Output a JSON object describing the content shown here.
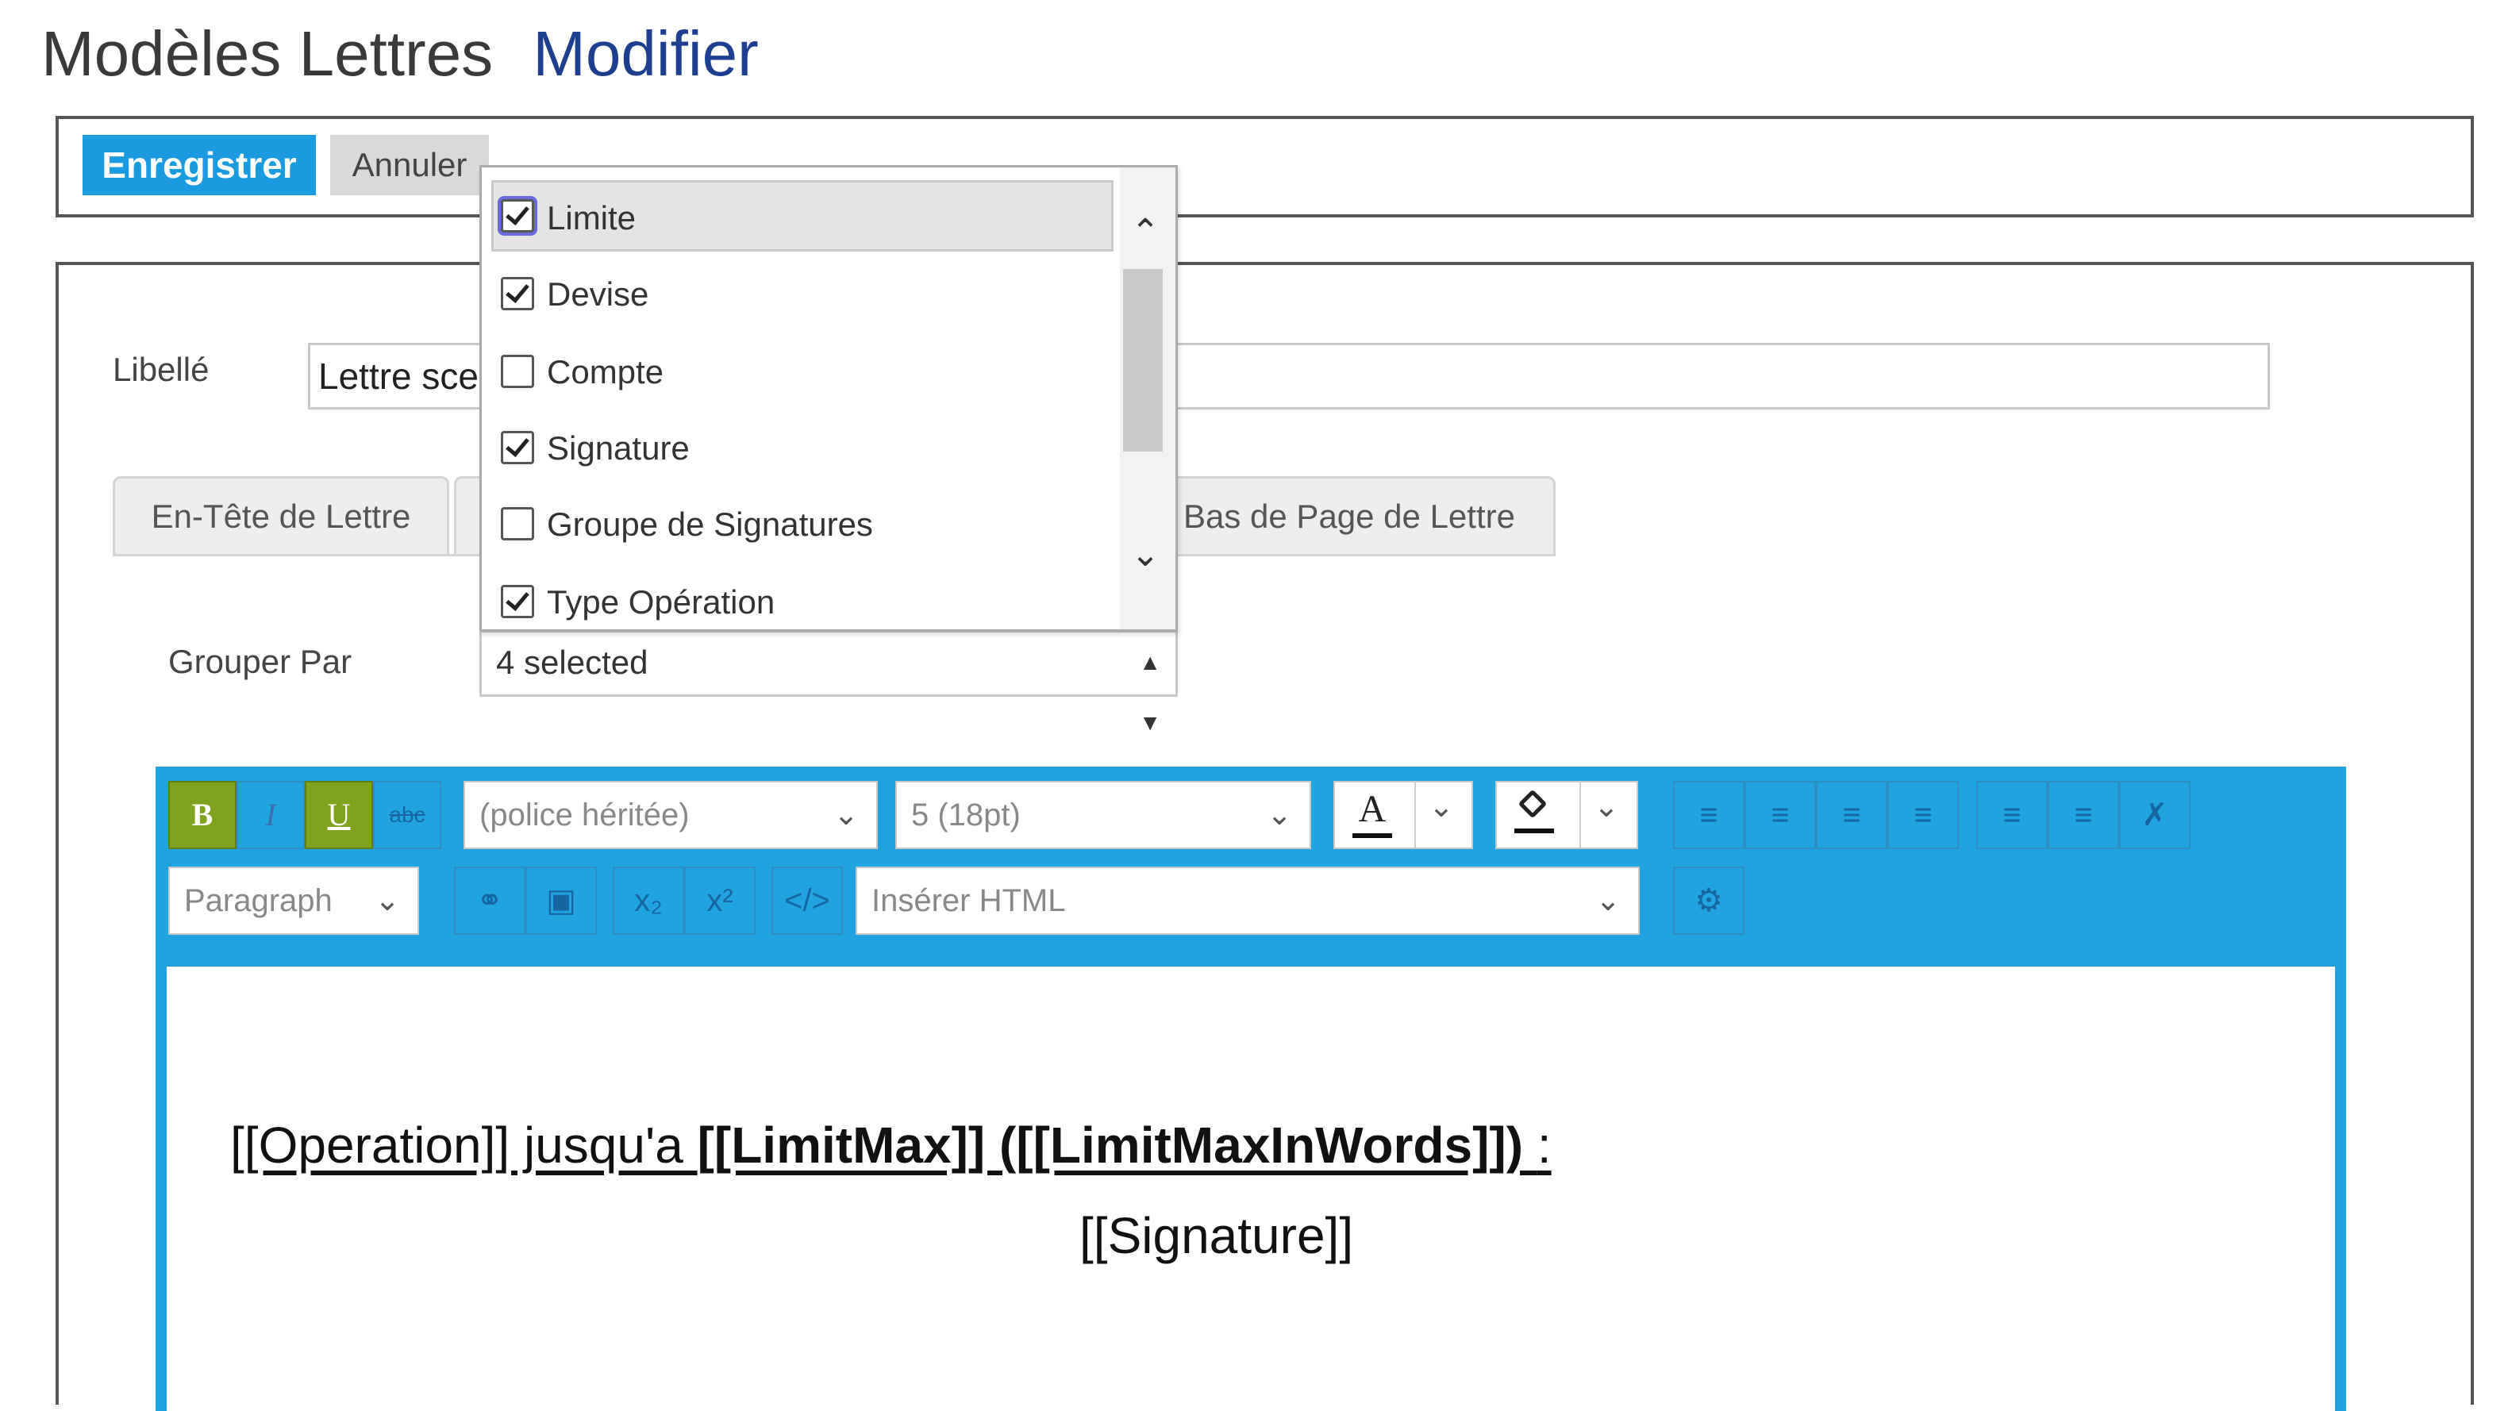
{
  "page": {
    "title": "Modèles Lettres",
    "subtitle": "Modifier"
  },
  "toolbar": {
    "save_label": "Enregistrer",
    "cancel_label": "Annuler"
  },
  "form": {
    "libelle_label": "Libellé",
    "libelle_value": "Lettre sce",
    "group_by_label": "Grouper Par",
    "group_by_summary": "4 selected"
  },
  "tabs": [
    {
      "label": "En-Tête de Lettre"
    },
    {
      "label": ""
    },
    {
      "label": "Bas de Page de Lettre"
    }
  ],
  "dropdown": {
    "items": [
      {
        "label": "Limite",
        "checked": true,
        "highlighted": true
      },
      {
        "label": "Devise",
        "checked": true
      },
      {
        "label": "Compte",
        "checked": false
      },
      {
        "label": "Signature",
        "checked": true
      },
      {
        "label": "Groupe de Signatures",
        "checked": false
      },
      {
        "label": "Type Opération",
        "checked": true
      }
    ]
  },
  "editor": {
    "bold": "B",
    "italic": "I",
    "underline": "U",
    "strike": "abc",
    "font_family": "(police héritée)",
    "font_size": "5 (18pt)",
    "font_color_glyph": "A",
    "block_format": "Paragraph",
    "insert_html": "Insérer HTML",
    "line1_plain": " [[Operation]] jusqu'a ",
    "line1_bold": "[[LimitMax]] ([[LimitMaxInWords]]) ",
    "line1_end": ":",
    "line2": "[[Signature]]"
  }
}
